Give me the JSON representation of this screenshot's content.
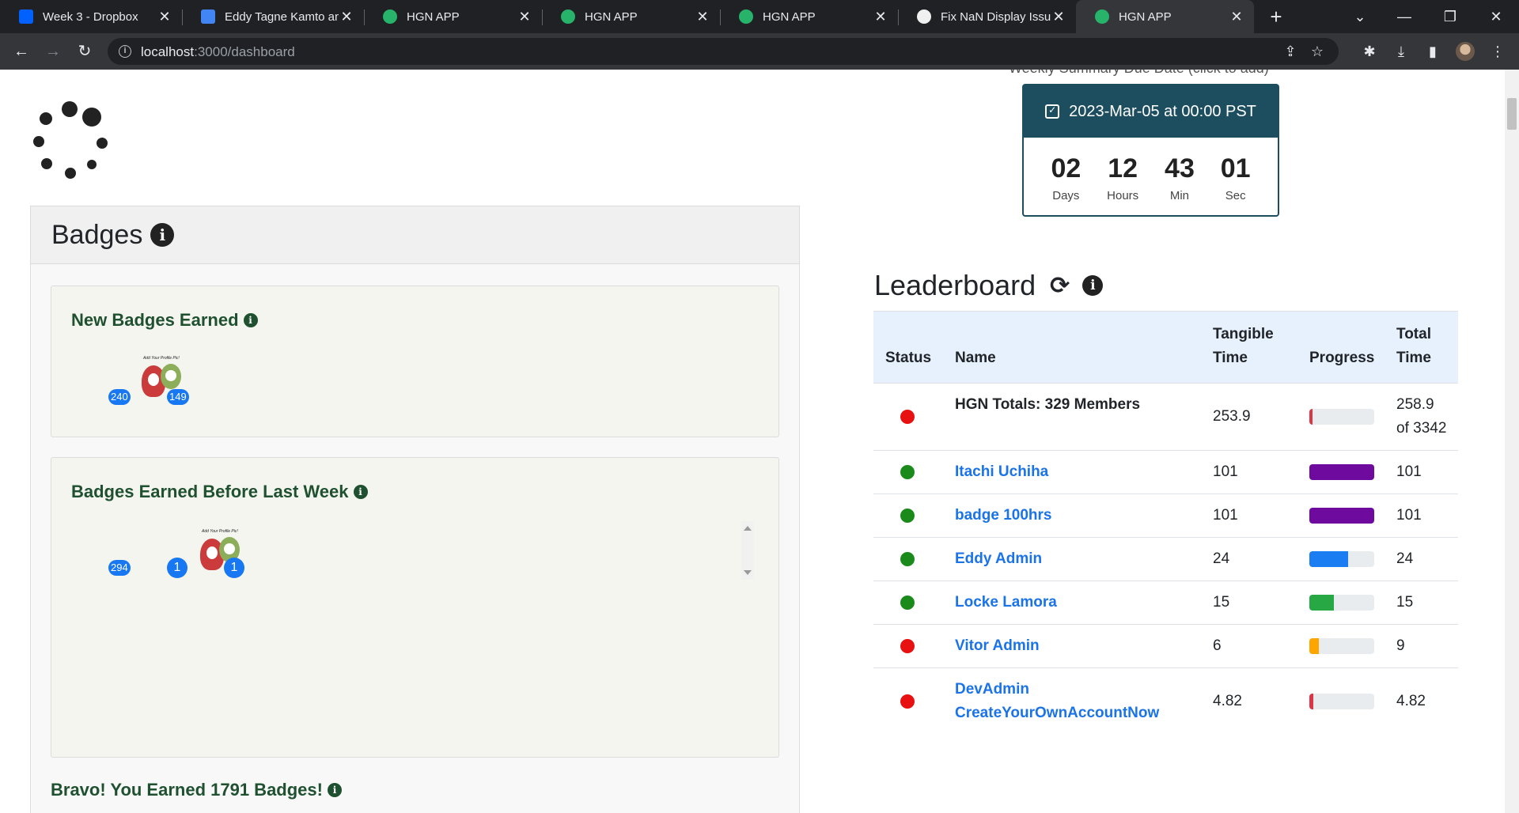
{
  "browser": {
    "tabs": [
      {
        "title": "Week 3 - Dropbox",
        "icon": "dropbox-icon",
        "color": "#0061fe"
      },
      {
        "title": "Eddy Tagne Kamto an",
        "icon": "docs-icon",
        "color": "#4285f4"
      },
      {
        "title": "HGN APP",
        "icon": "hgn-icon",
        "color": "#27b36a"
      },
      {
        "title": "HGN APP",
        "icon": "hgn-icon",
        "color": "#27b36a"
      },
      {
        "title": "HGN APP",
        "icon": "hgn-icon",
        "color": "#27b36a"
      },
      {
        "title": "Fix NaN Display Issue",
        "icon": "github-icon",
        "color": "#f0f0f0"
      },
      {
        "title": "HGN APP",
        "icon": "hgn-icon",
        "color": "#27b36a"
      }
    ],
    "url_host": "localhost",
    "url_rest": ":3000/dashboard"
  },
  "badges": {
    "title": "Badges",
    "new_title": "New Badges Earned",
    "new_counts": [
      "240",
      "149"
    ],
    "badge_caption": "Add Your Profile Pic!",
    "before_title": "Badges Earned Before Last Week",
    "before_counts": [
      "294",
      "1",
      "1"
    ],
    "bravo": "Bravo! You Earned 1791 Badges!"
  },
  "summary": {
    "caption": "Weekly Summary Due Date (click to add)",
    "due": "2023-Mar-05 at 00:00 PST",
    "timer": [
      {
        "num": "02",
        "label": "Days"
      },
      {
        "num": "12",
        "label": "Hours"
      },
      {
        "num": "43",
        "label": "Min"
      },
      {
        "num": "01",
        "label": "Sec"
      }
    ]
  },
  "leaderboard": {
    "title": "Leaderboard",
    "headers": [
      "Status",
      "Name",
      "Tangible Time",
      "Progress",
      "Total Time"
    ],
    "totals": {
      "name": "HGN Totals: 329 Members",
      "tangible": "253.9",
      "total": "258.9 of 3342",
      "progress": 0.05,
      "bar_color": "#dc3545"
    },
    "rows": [
      {
        "status": "green",
        "name": "Itachi Uchiha",
        "tangible": "101",
        "total": "101",
        "progress": 1.0,
        "bar_color": "#6f0a9f"
      },
      {
        "status": "green",
        "name": "badge 100hrs",
        "tangible": "101",
        "total": "101",
        "progress": 1.0,
        "bar_color": "#6f0a9f"
      },
      {
        "status": "green",
        "name": "Eddy Admin",
        "tangible": "24",
        "total": "24",
        "progress": 0.6,
        "bar_color": "#1a7ef2"
      },
      {
        "status": "green",
        "name": "Locke Lamora",
        "tangible": "15",
        "total": "15",
        "progress": 0.38,
        "bar_color": "#28a745"
      },
      {
        "status": "red",
        "name": "Vitor Admin",
        "tangible": "6",
        "total": "9",
        "progress": 0.15,
        "bar_color": "#ffa500"
      },
      {
        "status": "red",
        "name": "DevAdmin CreateYourOwnAccountNow",
        "tangible": "4.82",
        "total": "4.82",
        "progress": 0.06,
        "bar_color": "#dc3545"
      }
    ]
  },
  "colors": {
    "green_status": "#1a8a1a",
    "red_status": "#e81010",
    "link": "#1a73e8"
  }
}
